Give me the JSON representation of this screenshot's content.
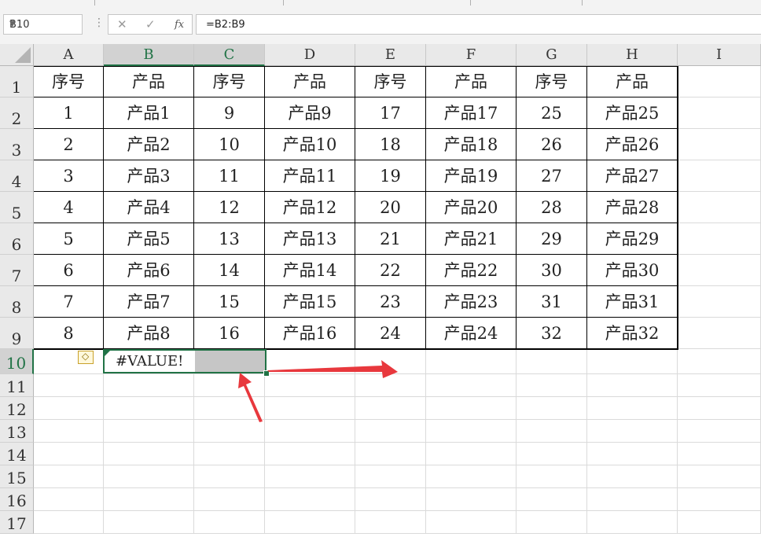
{
  "formula_bar": {
    "name_box": "B10",
    "cancel_symbol": "✕",
    "enter_symbol": "✓",
    "function_symbol": "fx",
    "formula": "=B2:B9"
  },
  "columns": [
    "A",
    "B",
    "C",
    "D",
    "E",
    "F",
    "G",
    "H",
    "I"
  ],
  "selected_columns": [
    "B",
    "C"
  ],
  "rows": [
    "1",
    "2",
    "3",
    "4",
    "5",
    "6",
    "7",
    "8",
    "9",
    "10",
    "11",
    "12",
    "13",
    "14",
    "15",
    "16",
    "17"
  ],
  "selected_row": "10",
  "table": {
    "header": [
      "序号",
      "产品",
      "序号",
      "产品",
      "序号",
      "产品",
      "序号",
      "产品"
    ],
    "body": [
      [
        "1",
        "产品1",
        "9",
        "产品9",
        "17",
        "产品17",
        "25",
        "产品25"
      ],
      [
        "2",
        "产品2",
        "10",
        "产品10",
        "18",
        "产品18",
        "26",
        "产品26"
      ],
      [
        "3",
        "产品3",
        "11",
        "产品11",
        "19",
        "产品19",
        "27",
        "产品27"
      ],
      [
        "4",
        "产品4",
        "12",
        "产品12",
        "20",
        "产品20",
        "28",
        "产品28"
      ],
      [
        "5",
        "产品5",
        "13",
        "产品13",
        "21",
        "产品21",
        "29",
        "产品29"
      ],
      [
        "6",
        "产品6",
        "14",
        "产品14",
        "22",
        "产品22",
        "30",
        "产品30"
      ],
      [
        "7",
        "产品7",
        "15",
        "产品15",
        "23",
        "产品23",
        "31",
        "产品31"
      ],
      [
        "8",
        "产品8",
        "16",
        "产品16",
        "24",
        "产品24",
        "32",
        "产品32"
      ]
    ]
  },
  "active_cell": {
    "ref": "B10",
    "value": "#VALUE!"
  },
  "colors": {
    "accent": "#217346",
    "arrow": "#e8383d",
    "selection_fill": "#c6c6c6"
  }
}
